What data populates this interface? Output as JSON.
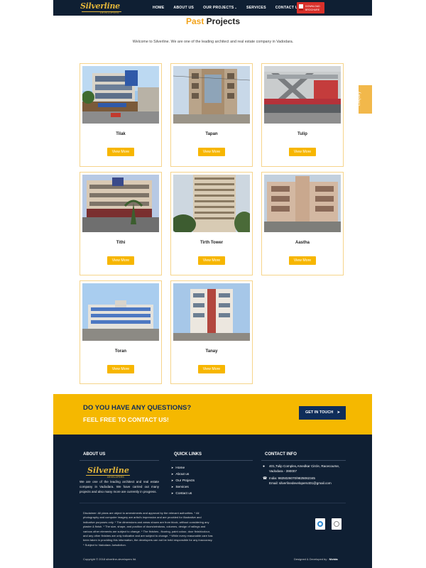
{
  "nav": {
    "logo_text": "Silverline",
    "logo_tag": "DEVELOPERS",
    "menu": [
      "HOME",
      "ABOUT US",
      "OUR PROJECTS",
      "SERVICES",
      "CONTACT US"
    ],
    "projects_caret": "⌄",
    "brochure_line1": "DOWNLOAD",
    "brochure_line2": "BROCHURE"
  },
  "page": {
    "title_accent": "Past",
    "title_rest": "Projects",
    "intro": "Welcome to Silverline. We are one of the leading architect and real estate company in Vadodara."
  },
  "enquiry": "Enquiry",
  "projects": [
    {
      "name": "Tilak",
      "button": "View More"
    },
    {
      "name": "Tapan",
      "button": "View More"
    },
    {
      "name": "Tulip",
      "button": "View More"
    },
    {
      "name": "Tithi",
      "button": "View More"
    },
    {
      "name": "Tirth Tower",
      "button": "View More"
    },
    {
      "name": "Aastha",
      "button": "View More"
    },
    {
      "name": "Toran",
      "button": "View More"
    },
    {
      "name": "Tanay",
      "button": "View More"
    }
  ],
  "cta": {
    "question": "DO YOU HAVE ANY QUESTIONS?",
    "sub": "FEEL FREE TO CONTACT US!",
    "button": "GET IN TOUCH",
    "arrow": "➤"
  },
  "footer": {
    "about_title": "ABOUT US",
    "links_title": "QUICK LINKS",
    "contact_title": "CONTACT INFO",
    "about_text": "We are one of the leading architect and real estate company in Vadodara. We have carried out many projects and also many more are currently in progress.",
    "logo_text": "Silverline",
    "logo_tag": "DEVELOPERS",
    "links": [
      "Home",
      "About us",
      "Our Projects",
      "Services",
      "Contact us"
    ],
    "link_chevron": "➤",
    "address": "401,Tulip Complex,Amedkar Circle, Racecourse, Vadodara - 390007",
    "phone": "India: 9825026070/9825062345",
    "email": "Email: silverlinedevelopers401@gmail.com",
    "disclaimer": "Disclaimer: All plans are object to amendments and approval by the relevant authorities. * All photography and computer imagery are artist's impression and are provided for illustrative and indicative purposes only. * The dimensions and areas shown are from block, without considering any plaster & finish. * The size, shape, and position of doors/windows, columns, design of railings and various other elements are subject to change. * The finishes , flooring, paint colour, door finish/colour, and any other finishes are only indicative and are subject to change. * While every reasonable care has been taken in providing this information, the developers can not be held responsible for any inaccuracy. * Subject to Vadodara Jurisdiction.",
    "copyright": "Copyright © 2018 silverline-developers ltd.",
    "designed_by": "Designed & Developed by :",
    "designer": "Nivida"
  },
  "colors": {
    "navy": "#0f1f33",
    "accent": "#f2a31b",
    "button": "#f7b600",
    "cta_bg": "#f5b800",
    "cta_dark": "#0f2d5a"
  }
}
